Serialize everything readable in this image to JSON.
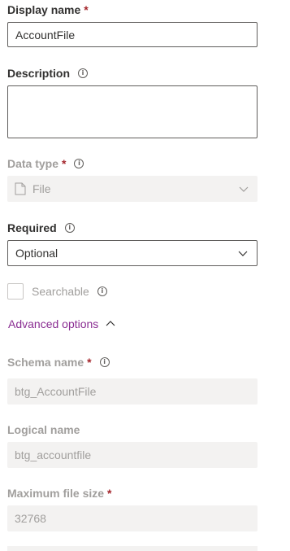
{
  "display_name": {
    "label": "Display name",
    "required_mark": "*",
    "value": "AccountFile"
  },
  "description": {
    "label": "Description",
    "info_icon": "info-icon",
    "value": ""
  },
  "data_type": {
    "label": "Data type",
    "required_mark": "*",
    "info_icon": "info-icon",
    "value": "File",
    "icon": "file-icon"
  },
  "required": {
    "label": "Required",
    "info_icon": "info-icon",
    "value": "Optional"
  },
  "searchable": {
    "label": "Searchable",
    "checked": false,
    "info_icon": "info-icon"
  },
  "advanced_options": {
    "label": "Advanced options",
    "icon": "chevron-up-icon",
    "link_color": "#8a2d92"
  },
  "schema_name": {
    "label": "Schema name",
    "required_mark": "*",
    "info_icon": "info-icon",
    "value": "btg_AccountFile"
  },
  "logical_name": {
    "label": "Logical name",
    "value": "btg_accountfile"
  },
  "max_file_size": {
    "label": "Maximum file size",
    "required_mark": "*",
    "value": "32768"
  }
}
